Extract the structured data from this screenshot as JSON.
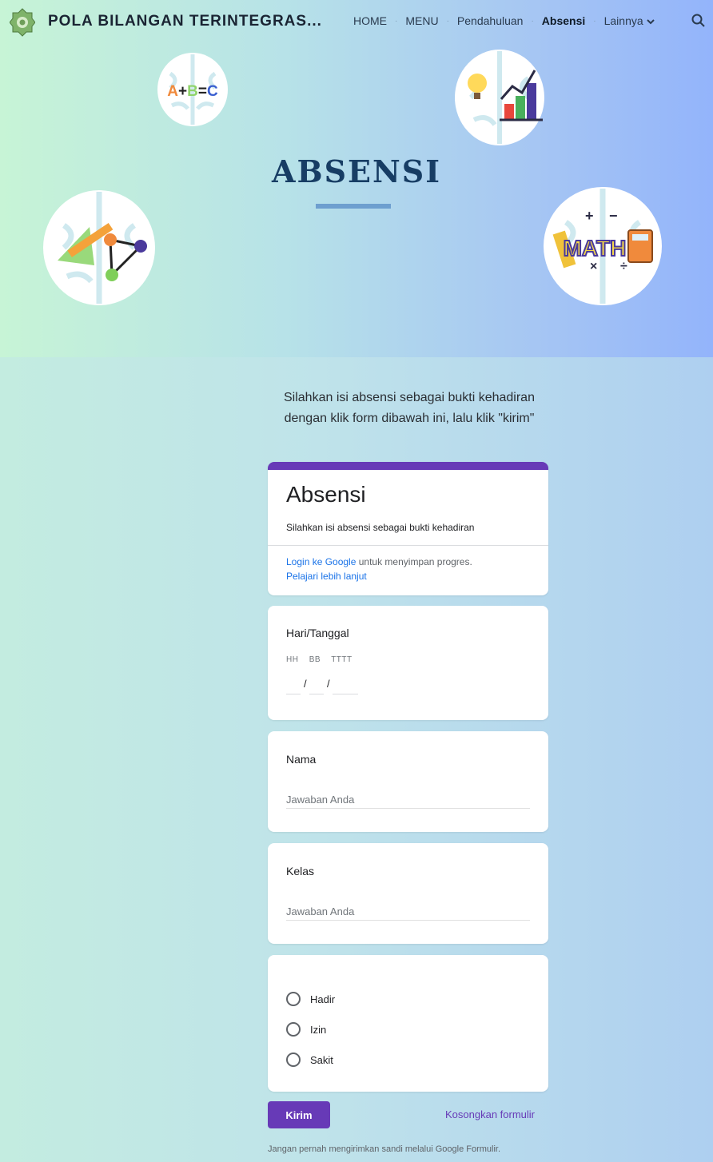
{
  "site": {
    "title": "POLA BILANGAN TERINTEGRAS...",
    "nav": [
      {
        "label": "HOME"
      },
      {
        "label": "MENU"
      },
      {
        "label": "Pendahuluan"
      },
      {
        "label": "Absensi",
        "active": true
      },
      {
        "label": "Lainnya"
      }
    ]
  },
  "hero": {
    "title": "ABSENSI",
    "brain_labels": {
      "top_left": "A+B=C",
      "right": "MATH"
    }
  },
  "intro": {
    "line1": "Silahkan isi absensi sebagai bukti kehadiran",
    "line2": "dengan klik form dibawah ini, lalu klik \"kirim\""
  },
  "form": {
    "title": "Absensi",
    "description": "Silahkan isi absensi sebagai bukti kehadiran",
    "login_link": "Login ke Google",
    "login_text": " untuk menyimpan progres.",
    "learn_more": "Pelajari lebih lanjut",
    "date_question": "Hari/Tanggal",
    "date_parts": [
      "HH",
      "BB",
      "TTTT"
    ],
    "name_question": "Nama",
    "class_question": "Kelas",
    "answer_placeholder": "Jawaban Anda",
    "options": [
      "Hadir",
      "Izin",
      "Sakit"
    ],
    "submit_label": "Kirim",
    "clear_label": "Kosongkan formulir",
    "footer": "Jangan pernah mengirimkan sandi melalui Google Formulir."
  },
  "colors": {
    "accent": "#673ab7",
    "heading": "#173d64",
    "link": "#1a73e8"
  }
}
